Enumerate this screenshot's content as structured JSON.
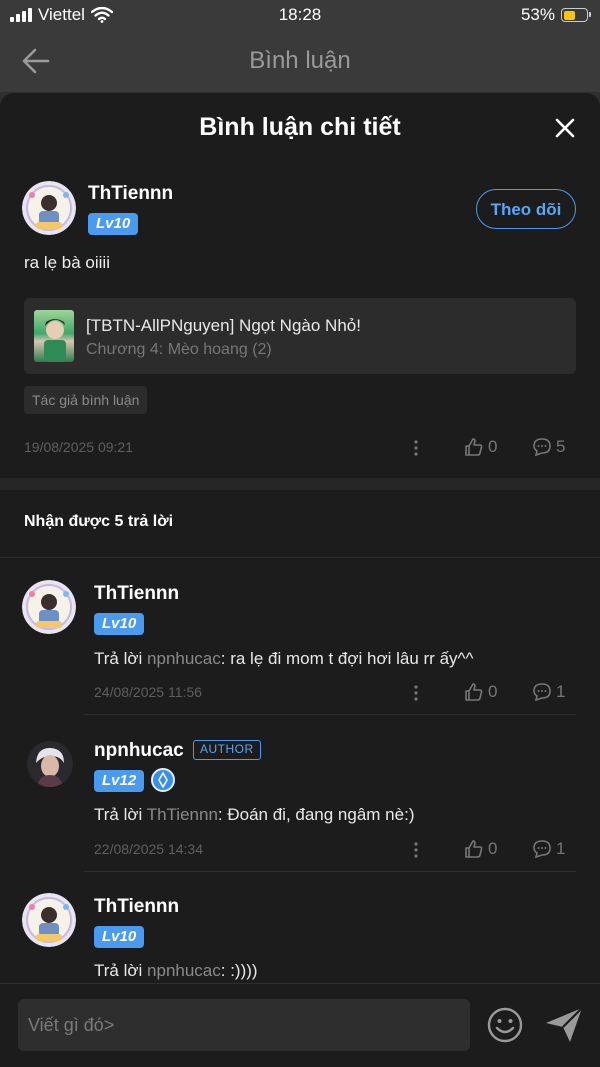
{
  "status_bar": {
    "carrier": "Viettel",
    "time": "18:28",
    "battery": "53%"
  },
  "nav": {
    "title": "Bình luận"
  },
  "sheet": {
    "title": "Bình luận chi tiết"
  },
  "comment": {
    "user": "ThTiennn",
    "level": "Lv10",
    "follow_label": "Theo dõi",
    "text": "ra lẹ bà oiiii",
    "book": {
      "title": "[TBTN-AllPNguyen] Ngọt Ngào Nhỏ!",
      "chapter": "Chương 4: Mèo hoang (2)"
    },
    "tag": "Tác giả bình luận",
    "date": "19/08/2025 09:21",
    "likes": "0",
    "replies": "5"
  },
  "replies_header": "Nhận được 5 trả lời",
  "replies": [
    {
      "user": "ThTiennn",
      "level": "Lv10",
      "prefix": "Trả lời ",
      "mention": "npnhucac",
      "text": ": ra lẹ đi mom t đợi hơi lâu rr ấy^^",
      "date": "24/08/2025 11:56",
      "likes": "0",
      "replies": "1"
    },
    {
      "user": "npnhucac",
      "badge": "AUTHOR",
      "level": "Lv12",
      "prefix": "Trả lời ",
      "mention": "ThTiennn",
      "text": ": Đoán đi, đang ngâm nè:)",
      "date": "22/08/2025 14:34",
      "likes": "0",
      "replies": "1"
    },
    {
      "user": "ThTiennn",
      "level": "Lv10",
      "prefix": "Trả lời ",
      "mention": "npnhucac",
      "text": ": :))))"
    }
  ],
  "composer": {
    "placeholder": "Viết gì đó>"
  },
  "colors": {
    "accent": "#4a9af0",
    "sheet_bg": "#1c1c1c",
    "battery": "#f5c518"
  }
}
